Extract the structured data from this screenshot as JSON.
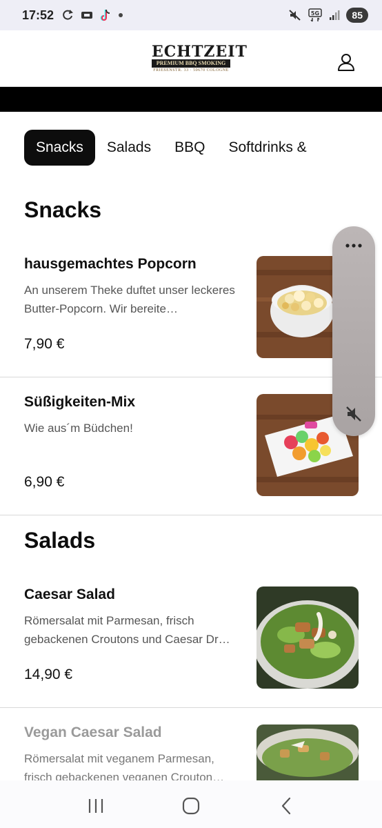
{
  "status_bar": {
    "time": "17:52",
    "battery": "85",
    "network": "5G"
  },
  "header": {
    "logo": {
      "title": "ECHTZEIT",
      "subtitle": "PREMIUM BBQ SMOKING",
      "address": "FRIESENSTR. 33 · 50670 COLOGNE"
    }
  },
  "tabs": [
    {
      "label": "Snacks",
      "active": true
    },
    {
      "label": "Salads",
      "active": false
    },
    {
      "label": "BBQ",
      "active": false
    },
    {
      "label": "Softdrinks &",
      "active": false
    }
  ],
  "sections": [
    {
      "title": "Snacks",
      "items": [
        {
          "name": "hausgemachtes Popcorn",
          "description": "An unserem Theke duftet unser leckeres Butter-Popcorn. Wir bereite…",
          "price": "7,90 €",
          "image": "popcorn-bowl"
        },
        {
          "name": "Süßigkeiten-Mix",
          "description": "Wie aus´m Büdchen!",
          "price": "6,90 €",
          "image": "candy-plate"
        }
      ]
    },
    {
      "title": "Salads",
      "items": [
        {
          "name": "Caesar Salad",
          "description": "Römersalat mit Parmesan, frisch gebackenen Croutons und Caesar Dr…",
          "price": "14,90 €",
          "image": "caesar-salad"
        },
        {
          "name": "Vegan Caesar Salad",
          "description": "Römersalat mit veganem Parmesan, frisch gebackenen veganen Crouton…",
          "price": "",
          "image": "vegan-caesar-salad"
        }
      ]
    }
  ],
  "floating_panel": {
    "icons": [
      "more-dots-icon",
      "mute-icon"
    ]
  },
  "nav_bar": {
    "icons": [
      "recents-icon",
      "home-icon",
      "back-icon"
    ]
  },
  "colors": {
    "accent": "#0d0d0d",
    "status_bar_bg": "#eeeef6",
    "divider": "#d8d8d8"
  }
}
